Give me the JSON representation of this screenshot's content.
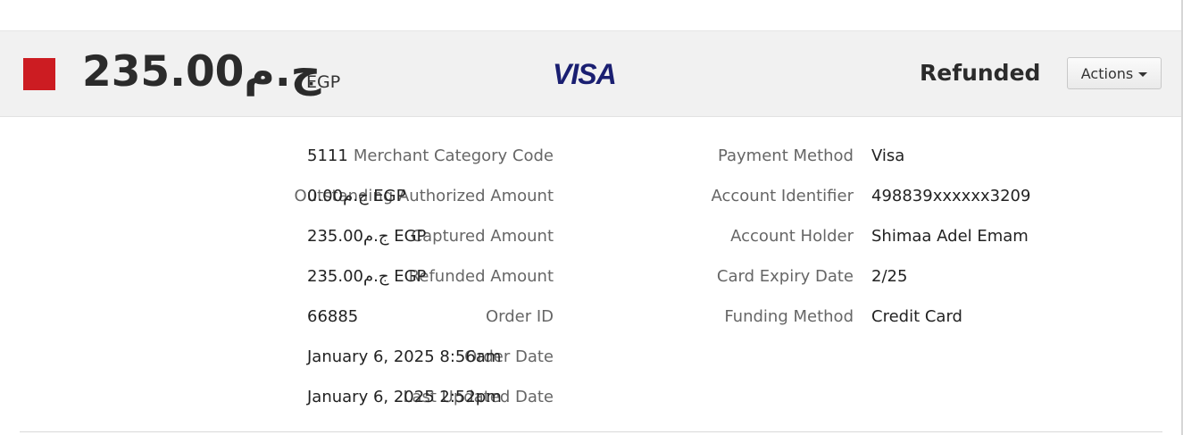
{
  "header": {
    "status_color": "#cc1c22",
    "amount": "235.00ج.م",
    "currency": "EGP",
    "brand": "VISA",
    "brand_color": "#1a1f71",
    "status": "Refunded",
    "actions_label": "Actions"
  },
  "details_left": [
    {
      "label": "Merchant Category Code",
      "value": "5111"
    },
    {
      "label": "Outstanding Authorized Amount",
      "value": "0.00ج.م EGP"
    },
    {
      "label": "Captured Amount",
      "value": "235.00ج.م EGP"
    },
    {
      "label": "Refunded Amount",
      "value": "235.00ج.م EGP"
    },
    {
      "label": "Order ID",
      "value": "66885"
    },
    {
      "label": "Order Date",
      "value": "January 6, 2025 8:56am"
    },
    {
      "label": "Last Updated Date",
      "value": "January 6, 2025 2:52pm"
    }
  ],
  "details_right": [
    {
      "label": "Payment Method",
      "value": "Visa"
    },
    {
      "label": "Account Identifier",
      "value": "498839xxxxxx3209"
    },
    {
      "label": "Account Holder",
      "value": "Shimaa Adel Emam"
    },
    {
      "label": "Card Expiry Date",
      "value": "2/25"
    },
    {
      "label": "Funding Method",
      "value": "Credit Card"
    }
  ]
}
